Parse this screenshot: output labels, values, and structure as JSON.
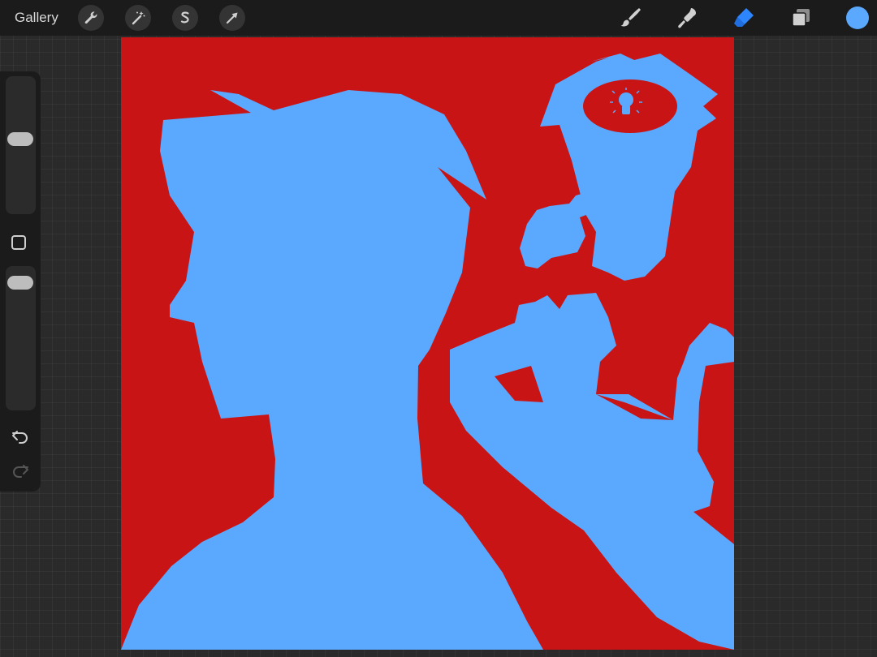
{
  "app": {
    "gallery_label": "Gallery"
  },
  "toolbar": {
    "left_tools": [
      "wrench-icon",
      "magic-wand-icon",
      "selection-icon",
      "transform-arrow-icon"
    ],
    "right_tools": [
      "brush-icon",
      "smudge-icon",
      "eraser-icon",
      "layers-icon"
    ],
    "active_tool": "eraser",
    "active_color": "#5aa9ff",
    "icon_color": "#d0d0d0",
    "active_icon_color": "#2e86ff"
  },
  "sidebar": {
    "tools": [
      "brush-size-slider",
      "modify-button",
      "opacity-slider",
      "undo-button",
      "redo-button"
    ]
  },
  "canvas": {
    "background_color": "#c81414",
    "silhouette_color": "#5aa9ff"
  }
}
